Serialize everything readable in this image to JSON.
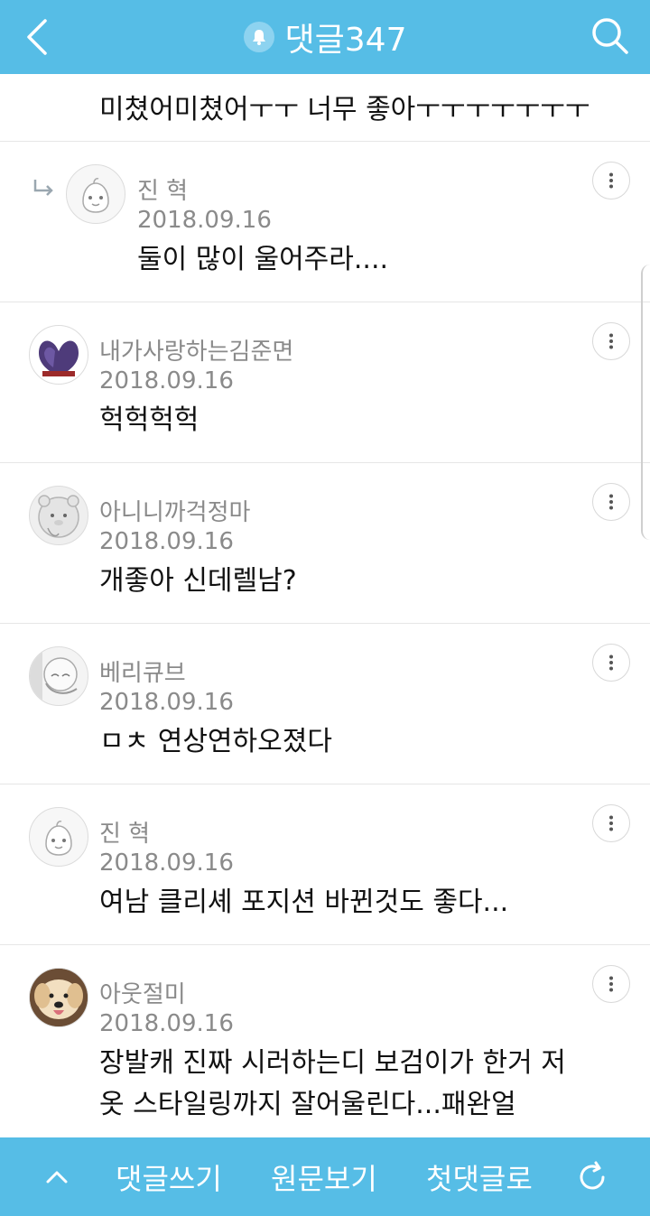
{
  "header": {
    "title": "댓글347",
    "back_icon": "chevron-left-icon",
    "bell_icon": "bell-icon",
    "search_icon": "search-icon"
  },
  "top_comment": {
    "text": "미쳤어미쳤어ㅜㅜ 너무 좋아ㅜㅜㅜㅜㅜㅜㅜ"
  },
  "comments": [
    {
      "author": "진 혁",
      "date": "2018.09.16",
      "text": "둘이 많이 울어주라....",
      "reply": true
    },
    {
      "author": "내가사랑하는김준면",
      "date": "2018.09.16",
      "text": "헉헉헉헉",
      "reply": false
    },
    {
      "author": "아니니까걱정마",
      "date": "2018.09.16",
      "text": "개좋아 신데렐남?",
      "reply": false
    },
    {
      "author": "베리큐브",
      "date": "2018.09.16",
      "text": "ㅁㅊ 연상연하오졌다",
      "reply": false
    },
    {
      "author": "진 혁",
      "date": "2018.09.16",
      "text": "여남 클리셰 포지션 바뀐것도 좋다...",
      "reply": false
    },
    {
      "author": "아웃절미",
      "date": "2018.09.16",
      "text_line1": "장발캐 진짜 시러하는디 보검이가 한거 저",
      "text_line2": "옷 스타일링까지 잘어울린다...패완얼",
      "reply": false
    }
  ],
  "bottom_bar": {
    "up_icon": "chevron-up-icon",
    "write_label": "댓글쓰기",
    "original_label": "원문보기",
    "first_label": "첫댓글로",
    "refresh_icon": "refresh-icon"
  },
  "colors": {
    "accent": "#56bde6",
    "meta_text": "#8a8a8a",
    "divider": "#e6e6e6"
  }
}
